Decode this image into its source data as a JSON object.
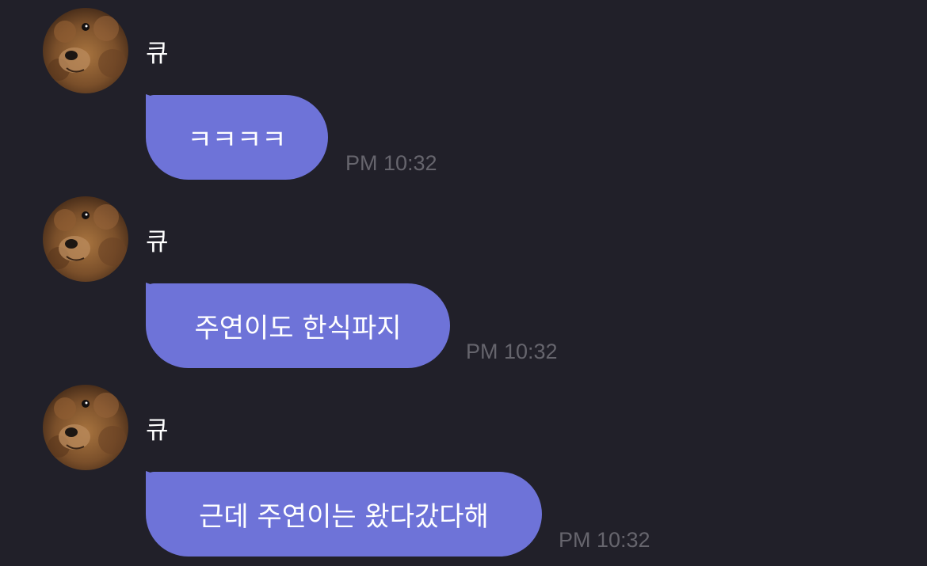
{
  "messages": [
    {
      "sender": "큐",
      "text": "ㅋㅋㅋㅋ",
      "time": "PM 10:32"
    },
    {
      "sender": "큐",
      "text": "주연이도 한식파지",
      "time": "PM 10:32"
    },
    {
      "sender": "큐",
      "text": "근데 주연이는 왔다갔다해",
      "time": "PM 10:32"
    }
  ],
  "colors": {
    "background": "#212029",
    "bubble": "#6e73d8",
    "timestamp": "#66656d",
    "text": "#ffffff"
  },
  "icons": {
    "avatar": "dog-avatar-icon"
  }
}
